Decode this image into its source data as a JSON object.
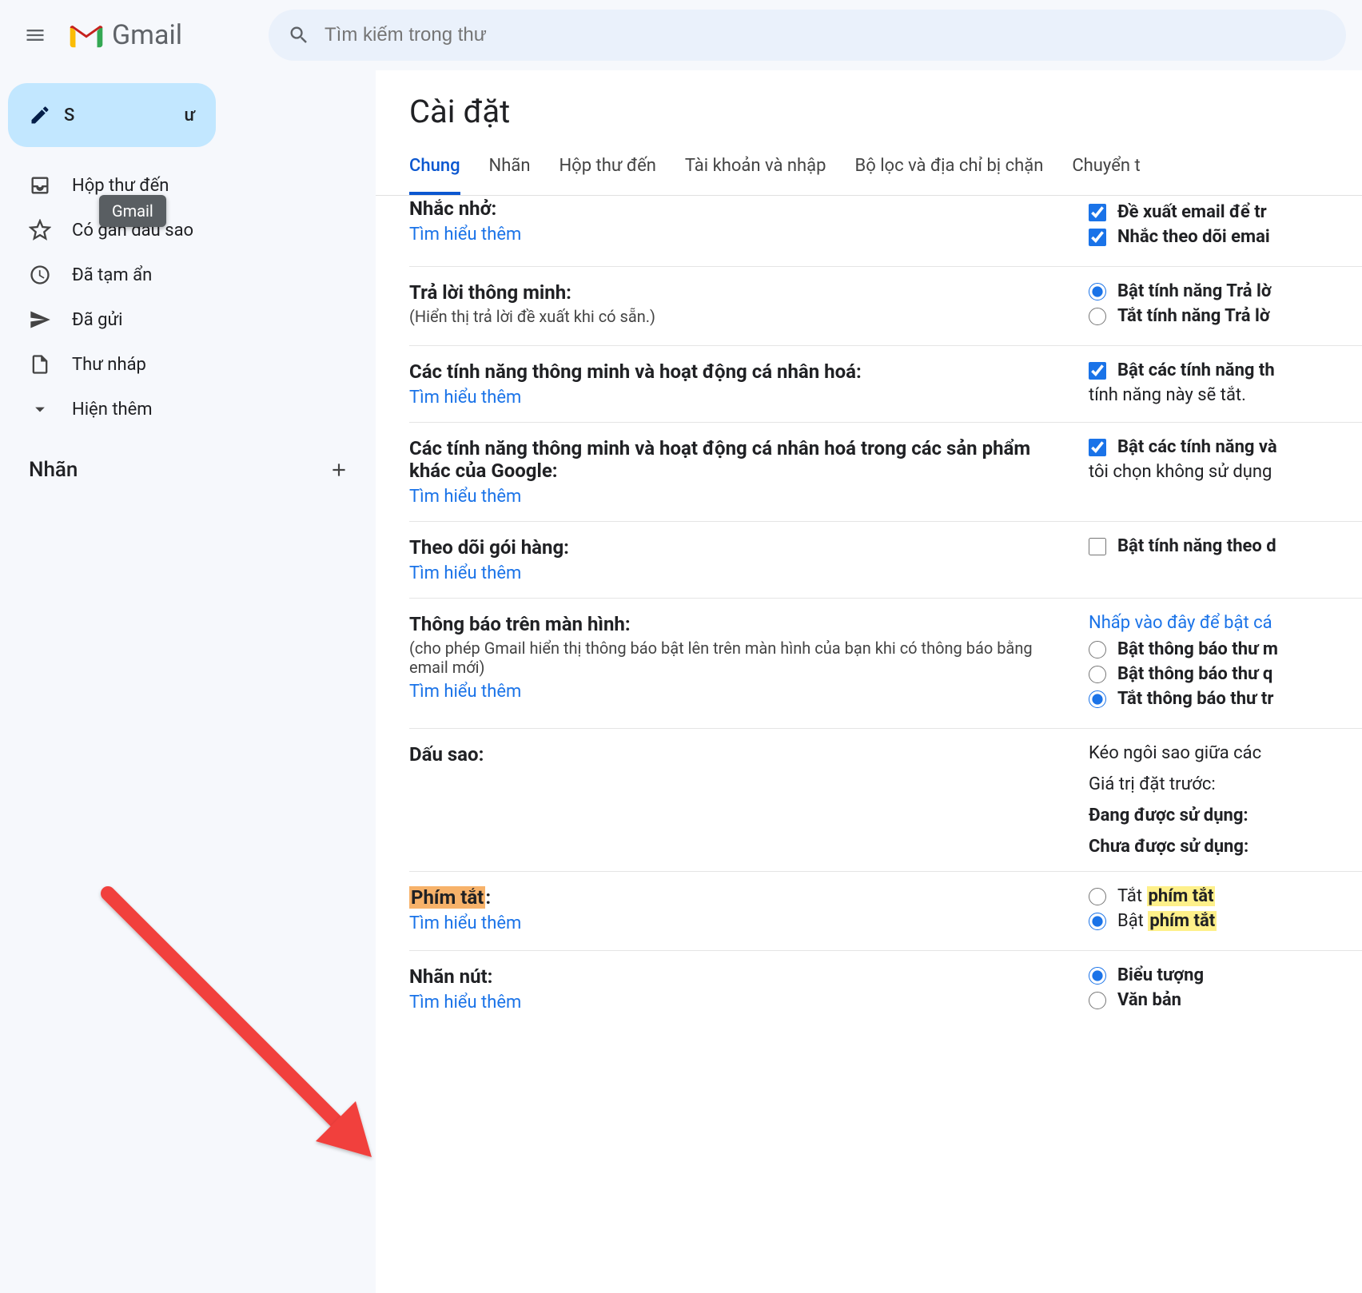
{
  "header": {
    "app_name": "Gmail",
    "search_placeholder": "Tìm kiếm trong thư",
    "tooltip": "Gmail"
  },
  "sidebar": {
    "compose_prefix": "S",
    "compose_suffix": "ư",
    "items": [
      {
        "label": "Hộp thư đến",
        "icon": "inbox"
      },
      {
        "label": "Có gắn dấu sao",
        "icon": "star"
      },
      {
        "label": "Đã tạm ẩn",
        "icon": "clock"
      },
      {
        "label": "Đã gửi",
        "icon": "send"
      },
      {
        "label": "Thư nháp",
        "icon": "file"
      },
      {
        "label": "Hiện thêm",
        "icon": "chevron-down"
      }
    ],
    "labels_header": "Nhãn"
  },
  "settings": {
    "title": "Cài đặt",
    "tabs": [
      "Chung",
      "Nhãn",
      "Hộp thư đến",
      "Tài khoản và nhập",
      "Bộ lọc và địa chỉ bị chặn",
      "Chuyển t"
    ],
    "learn_more": "Tìm hiểu thêm",
    "rows": {
      "reminder": {
        "title": "Nhắc nhở:",
        "opt1": "Đề xuất email để tr",
        "opt2": "Nhắc theo dõi emai"
      },
      "smart_reply": {
        "title": "Trả lời thông minh:",
        "sub": "(Hiển thị trả lời đề xuất khi có sẵn.)",
        "on": "Bật tính năng Trả lờ",
        "off": "Tắt tính năng Trả lờ"
      },
      "smart_features": {
        "title": "Các tính năng thông minh và hoạt động cá nhân hoá:",
        "opt": "Bật các tính năng th",
        "desc": "tính năng này sẽ tắt."
      },
      "smart_features_other": {
        "title": "Các tính năng thông minh và hoạt động cá nhân hoá trong các sản phẩm khác của Google:",
        "opt": "Bật các tính năng và",
        "desc": "tôi chọn không sử dụng"
      },
      "package": {
        "title": "Theo dõi gói hàng:",
        "opt": "Bật tính năng theo d"
      },
      "desktop_notif": {
        "title": "Thông báo trên màn hình:",
        "sub": "(cho phép Gmail hiển thị thông báo bật lên trên màn hình của bạn khi có thông báo bằng email mới)",
        "link": "Nhấp vào đây để bật cá",
        "o1": "Bật thông báo thư m",
        "o2": "Bật thông báo thư q",
        "o3": "Tắt thông báo thư tr"
      },
      "stars": {
        "title": "Dấu sao:",
        "l1": "Kéo ngôi sao giữa các",
        "l2": "Giá trị đặt trước:",
        "l3": "Đang được sử dụng:",
        "l4": "Chưa được sử dụng:"
      },
      "shortcuts": {
        "title": "Phím tắt",
        "off_pre": "Tắt ",
        "off_hl": "phím tắt",
        "on_pre": "Bật ",
        "on_hl": "phím tắt"
      },
      "button_labels": {
        "title": "Nhãn nút:",
        "o1": "Biểu tượng",
        "o2": "Văn bản"
      }
    }
  }
}
